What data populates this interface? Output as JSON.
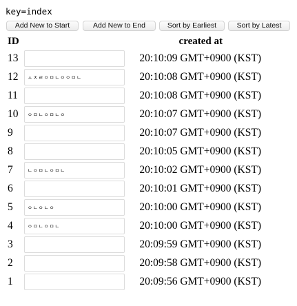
{
  "key_label": "key=index",
  "buttons": {
    "add_start": "Add New to Start",
    "add_end": "Add New to End",
    "sort_earliest": "Sort by Earliest",
    "sort_latest": "Sort by Latest"
  },
  "table": {
    "headers": {
      "id": "ID",
      "created": "created at"
    },
    "rows": [
      {
        "id": "13",
        "value": "",
        "created": "20:10:09 GMT+0900 (KST)"
      },
      {
        "id": "12",
        "value": "ㅅㅈㄹㅇㅁㄴㅇㅇㅁㄴ",
        "created": "20:10:08 GMT+0900 (KST)"
      },
      {
        "id": "11",
        "value": "",
        "created": "20:10:08 GMT+0900 (KST)"
      },
      {
        "id": "10",
        "value": "ㅇㅁㄴㅇㅁㄴㅇ",
        "created": "20:10:07 GMT+0900 (KST)"
      },
      {
        "id": "9",
        "value": "",
        "created": "20:10:07 GMT+0900 (KST)"
      },
      {
        "id": "8",
        "value": "",
        "created": "20:10:05 GMT+0900 (KST)"
      },
      {
        "id": "7",
        "value": "ㄴㅇㅁㄴㅇㅁㄴ",
        "created": "20:10:02 GMT+0900 (KST)"
      },
      {
        "id": "6",
        "value": "",
        "created": "20:10:01 GMT+0900 (KST)"
      },
      {
        "id": "5",
        "value": "ㅇㄴㅇㄴㅇ",
        "created": "20:10:00 GMT+0900 (KST)"
      },
      {
        "id": "4",
        "value": "ㅇㅁㄴㅇㅁㄴ",
        "created": "20:10:00 GMT+0900 (KST)"
      },
      {
        "id": "3",
        "value": "",
        "created": "20:09:59 GMT+0900 (KST)"
      },
      {
        "id": "2",
        "value": "",
        "created": "20:09:58 GMT+0900 (KST)"
      },
      {
        "id": "1",
        "value": "",
        "created": "20:09:56 GMT+0900 (KST)"
      }
    ]
  }
}
